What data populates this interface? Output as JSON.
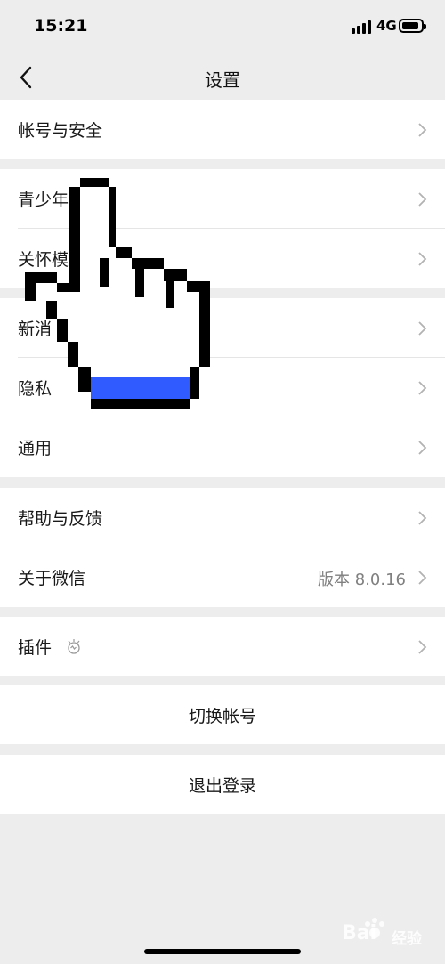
{
  "status_bar": {
    "time": "15:21",
    "network": "4G"
  },
  "nav": {
    "title": "设置"
  },
  "groups": [
    {
      "items": [
        {
          "label": "帐号与安全"
        }
      ]
    },
    {
      "items": [
        {
          "label": "青少年"
        },
        {
          "label": "关怀模"
        }
      ]
    },
    {
      "items": [
        {
          "label": "新消"
        },
        {
          "label": "隐私"
        },
        {
          "label": "通用"
        }
      ]
    },
    {
      "items": [
        {
          "label": "帮助与反馈"
        },
        {
          "label": "关于微信",
          "value": "版本 8.0.16"
        }
      ]
    },
    {
      "items": [
        {
          "label": "插件"
        }
      ]
    }
  ],
  "actions": {
    "switch_account": "切换帐号",
    "logout": "退出登录"
  },
  "watermark": {
    "brand": "Bai",
    "sub": "经验"
  },
  "colors": {
    "background": "#ededed",
    "cell": "#ffffff",
    "cursor_accent": "#2f5bff"
  }
}
